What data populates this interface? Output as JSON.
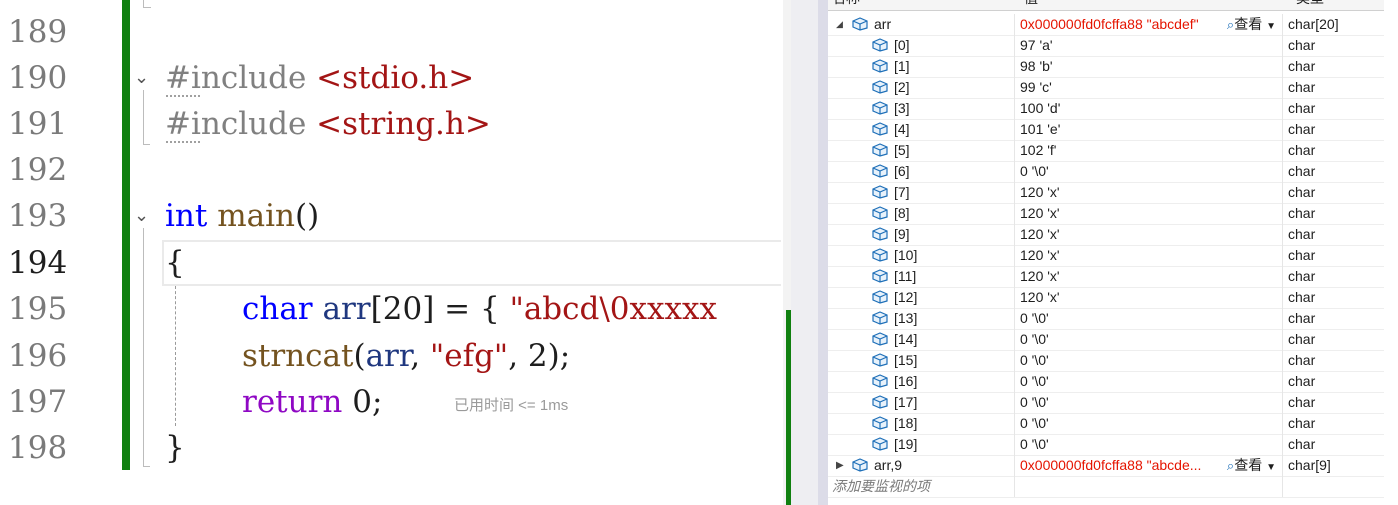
{
  "editor": {
    "line_numbers": [
      "189",
      "190",
      "191",
      "192",
      "193",
      "194",
      "195",
      "196",
      "197",
      "198"
    ],
    "current_line": "194",
    "lines": {
      "l190": {
        "kw": "#include",
        "arg": "<stdio.h>"
      },
      "l191": {
        "kw": "#include",
        "arg": "<string.h>"
      },
      "l193": {
        "type": "int",
        "fn": "main",
        "paren": "()"
      },
      "l194": {
        "brace": "{"
      },
      "l195": {
        "type": "char",
        "ident": "arr",
        "bracket_open": "[",
        "size": "20",
        "bracket_close": "]",
        "eq": " = { ",
        "str": "\"abcd\\0xxxxx"
      },
      "l196": {
        "fn": "strncat",
        "open": "(",
        "ident": "arr",
        "comma": ", ",
        "str": "\"efg\"",
        "rest": ", 2);"
      },
      "l197": {
        "kw": "return",
        "rest": " 0;",
        "hint": "已用时间 <= 1ms"
      },
      "l198": {
        "brace": "}"
      }
    },
    "fold_icon": "chevron-down-icon"
  },
  "watch": {
    "headers": {
      "name": "名称",
      "value": "值",
      "type": "类型"
    },
    "root": {
      "name": "arr",
      "value": "0x000000fd0fcffa88 \"abcdef\"",
      "view": "查看",
      "type": "char[20]"
    },
    "items": [
      {
        "name": "[0]",
        "value": "97 'a'",
        "type": "char"
      },
      {
        "name": "[1]",
        "value": "98 'b'",
        "type": "char"
      },
      {
        "name": "[2]",
        "value": "99 'c'",
        "type": "char"
      },
      {
        "name": "[3]",
        "value": "100 'd'",
        "type": "char"
      },
      {
        "name": "[4]",
        "value": "101 'e'",
        "type": "char"
      },
      {
        "name": "[5]",
        "value": "102 'f'",
        "type": "char"
      },
      {
        "name": "[6]",
        "value": "0 '\\0'",
        "type": "char"
      },
      {
        "name": "[7]",
        "value": "120 'x'",
        "type": "char"
      },
      {
        "name": "[8]",
        "value": "120 'x'",
        "type": "char"
      },
      {
        "name": "[9]",
        "value": "120 'x'",
        "type": "char"
      },
      {
        "name": "[10]",
        "value": "120 'x'",
        "type": "char"
      },
      {
        "name": "[11]",
        "value": "120 'x'",
        "type": "char"
      },
      {
        "name": "[12]",
        "value": "120 'x'",
        "type": "char"
      },
      {
        "name": "[13]",
        "value": "0 '\\0'",
        "type": "char"
      },
      {
        "name": "[14]",
        "value": "0 '\\0'",
        "type": "char"
      },
      {
        "name": "[15]",
        "value": "0 '\\0'",
        "type": "char"
      },
      {
        "name": "[16]",
        "value": "0 '\\0'",
        "type": "char"
      },
      {
        "name": "[17]",
        "value": "0 '\\0'",
        "type": "char"
      },
      {
        "name": "[18]",
        "value": "0 '\\0'",
        "type": "char"
      },
      {
        "name": "[19]",
        "value": "0 '\\0'",
        "type": "char"
      }
    ],
    "second": {
      "name": "arr,9",
      "value": "0x000000fd0fcffa88 \"abcde...",
      "view": "查看",
      "type": "char[9]"
    },
    "add_placeholder": "添加要监视的项"
  },
  "colors": {
    "accent_green": "#108010",
    "value_changed": "#e51400",
    "keyword": "#0000ff"
  }
}
